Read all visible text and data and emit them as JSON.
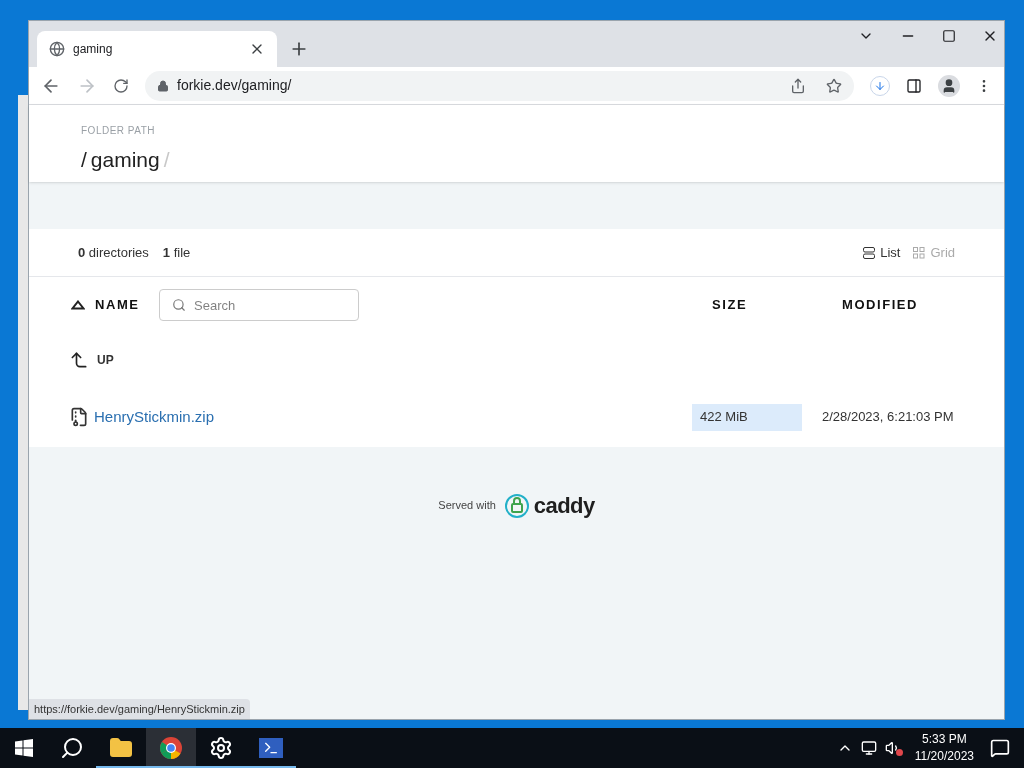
{
  "browser": {
    "tabs": [
      {
        "title": "gaming",
        "selected": true
      }
    ],
    "address": "forkie.dev/gaming/",
    "status_url": "https://forkie.dev/gaming/HenryStickmin.zip"
  },
  "page": {
    "folder_label": "FOLDER PATH",
    "path": [
      {
        "text": "/",
        "kind": "separator"
      },
      {
        "text": "gaming",
        "kind": "segment"
      },
      {
        "text": "/",
        "kind": "trailing"
      }
    ],
    "summary": [
      {
        "count": "0",
        "label": "directories"
      },
      {
        "count": "1",
        "label": "file"
      }
    ],
    "views": [
      {
        "label": "List",
        "kind": "list",
        "selected": true
      },
      {
        "label": "Grid",
        "kind": "grid",
        "selected": false
      }
    ],
    "columns": {
      "name": "NAME",
      "size": "SIZE",
      "modified": "MODIFIED"
    },
    "search": {
      "placeholder": "Search"
    },
    "rows": [
      {
        "kind": "up",
        "name": "UP"
      },
      {
        "kind": "file",
        "name": "HenryStickmin.zip",
        "size": "422 MiB",
        "modified": "2/28/2023, 6:21:03 PM"
      }
    ],
    "footer": {
      "text": "Served with",
      "brand": "caddy"
    }
  },
  "taskbar": {
    "apps": [
      {
        "kind": "explorer",
        "selected": false
      },
      {
        "kind": "chrome",
        "selected": true
      },
      {
        "kind": "settings",
        "selected": false
      },
      {
        "kind": "powershell",
        "selected": false
      }
    ],
    "time": "5:33 PM",
    "date": "11/20/2023"
  }
}
